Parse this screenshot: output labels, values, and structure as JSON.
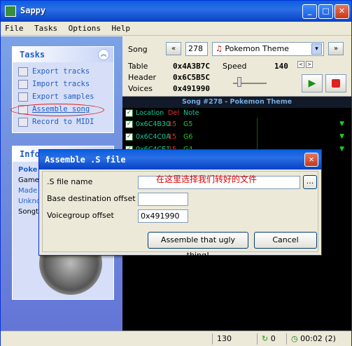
{
  "window": {
    "title": "Sappy"
  },
  "menu": [
    "File",
    "Tasks",
    "Options",
    "Help"
  ],
  "tasks": {
    "header": "Tasks",
    "items": [
      "Export tracks",
      "Import tracks",
      "Export samples",
      "Assemble song",
      "Record to MIDI"
    ]
  },
  "info": {
    "header": "Info",
    "lines": [
      "Poke",
      "Gamec",
      "Made",
      "Unkno",
      "Songt"
    ]
  },
  "song": {
    "label": "Song",
    "number": "278",
    "name": "Pokemon Theme",
    "table_label": "Table",
    "table_value": "0x4A3B7C",
    "header_label": "Header",
    "header_value": "0x6C5B5C",
    "voices_label": "Voices",
    "voices_value": "0x491990",
    "speed_label": "Speed",
    "speed_value": "140"
  },
  "track_grid": {
    "title": "Song #278 - Pokemon Theme",
    "columns": [
      "Location",
      "Del",
      "Note"
    ],
    "rows": [
      {
        "location": "0x6C4B30",
        "del": "15",
        "note": "G5"
      },
      {
        "location": "0x6C4C0A",
        "del": "15",
        "note": "G6"
      },
      {
        "location": "0x6C4CE1",
        "del": "15",
        "note": "G4"
      }
    ]
  },
  "status": {
    "position": "130",
    "loop": "0",
    "time": "00:02 (2)"
  },
  "dialog": {
    "title": "Assemble .S file",
    "file_label": ".S file name",
    "file_value": "",
    "browse_label": "...",
    "base_label": "Base destination offset",
    "base_value": "",
    "voice_label": "Voicegroup offset",
    "voice_value": "0x491990",
    "ok_label": "Assemble that ugly thing!",
    "cancel_label": "Cancel",
    "annotation": "在这里选择我们转好的文件"
  }
}
